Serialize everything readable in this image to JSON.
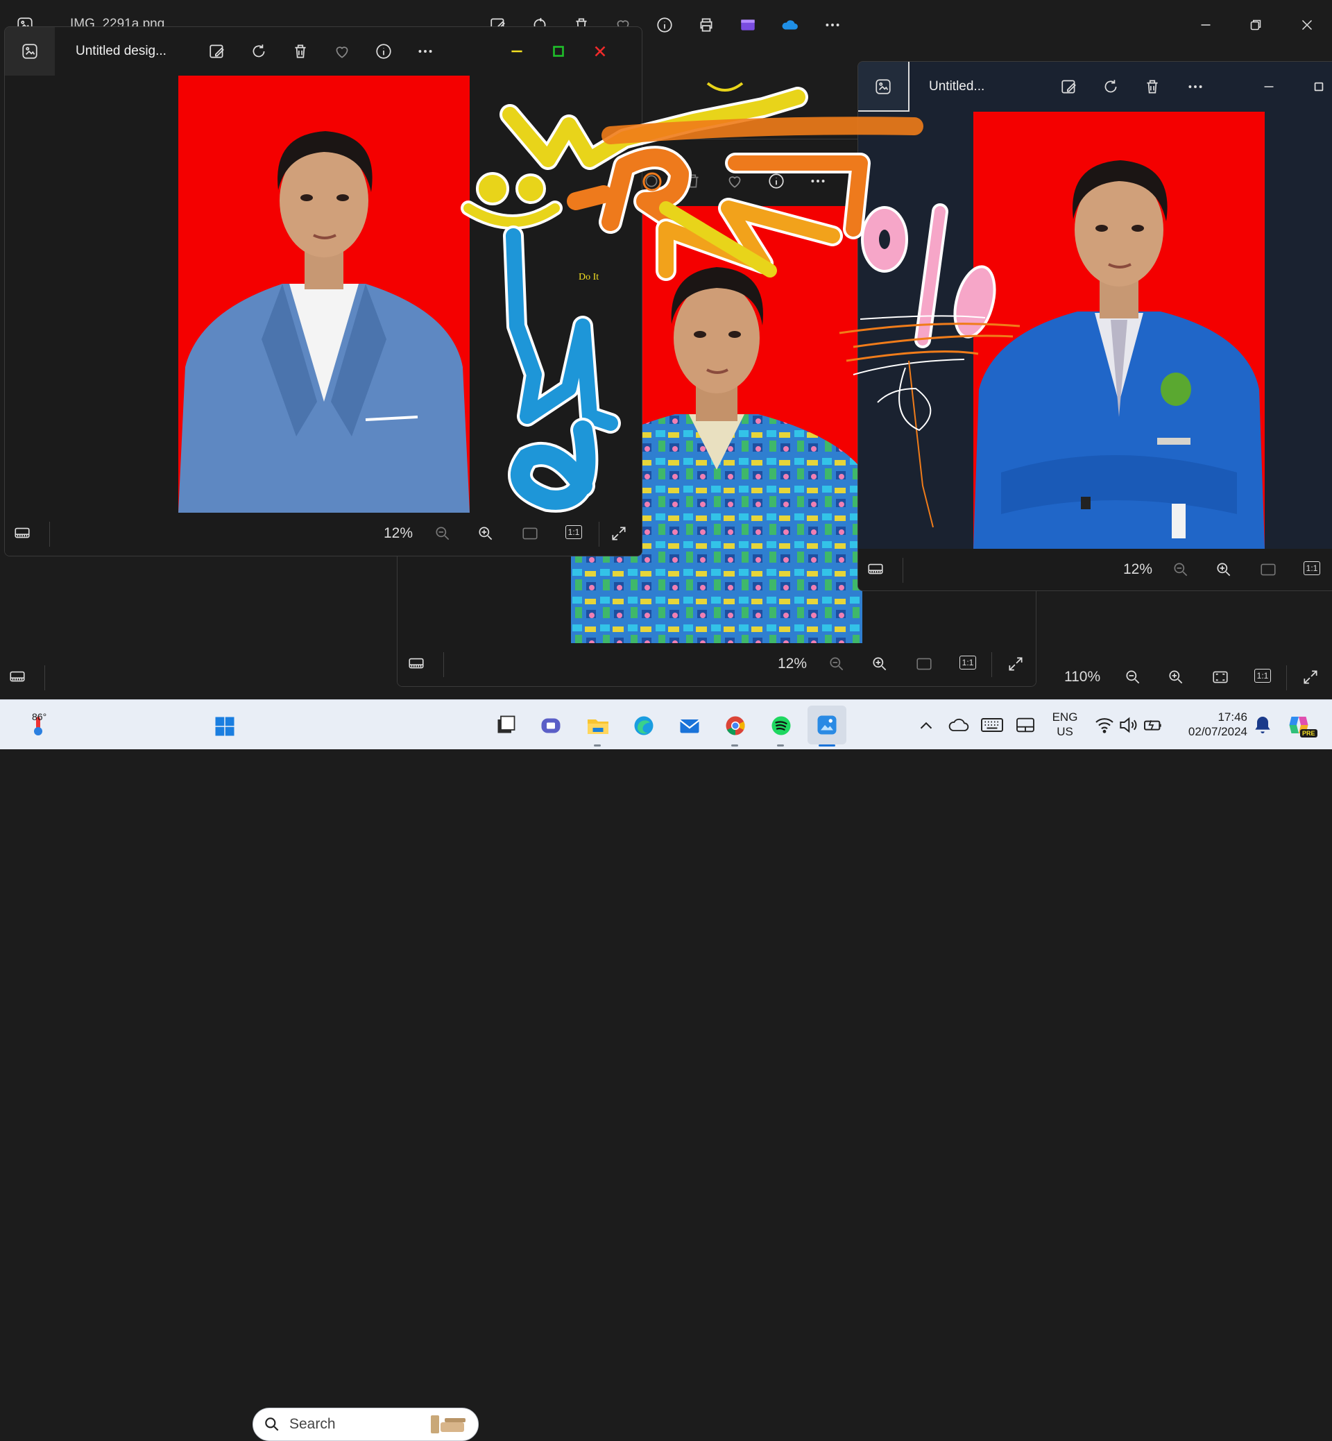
{
  "back_window": {
    "title": "IMG_2291a.png",
    "zoom": "110%"
  },
  "front_window": {
    "title": "Untitled desig...",
    "zoom": "12%",
    "annotation_text": "Do It",
    "actual_size_label": "1:1"
  },
  "middle_window": {
    "zoom": "12%",
    "actual_size_label": "1:1"
  },
  "right_window": {
    "title": "Untitled...",
    "zoom": "12%",
    "actual_size_label": "1:1"
  },
  "back_actual_size_label": "1:1",
  "taskbar": {
    "weather_temp": "86°",
    "search_placeholder": "Search",
    "language": "ENG",
    "region": "US",
    "time": "17:46",
    "date": "02/07/2024",
    "copilot_badge": "PRE"
  },
  "colors": {
    "photo_background": "#f40000",
    "window_bg": "#1b1b1b",
    "taskbar_bg": "#e9eef6",
    "minimize_yellow": "#f3df22",
    "maximize_green": "#1fbf2a",
    "close_red": "#f12b2b"
  }
}
